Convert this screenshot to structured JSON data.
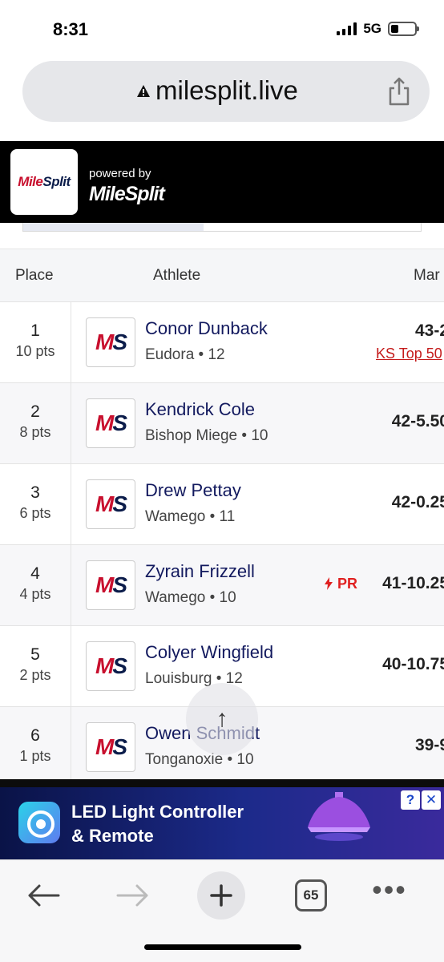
{
  "status_bar": {
    "time": "8:31",
    "network": "5G"
  },
  "browser": {
    "url": "milesplit.live",
    "tab_count": "65"
  },
  "site_header": {
    "logo_text": "MileSplit",
    "powered_by": "powered by",
    "brand": "MileSplit"
  },
  "table": {
    "columns": {
      "place": "Place",
      "athlete": "Athlete",
      "mark": "Mar"
    },
    "badge_text": "MS",
    "rows": [
      {
        "place": "1",
        "pts": "10 pts",
        "name": "Conor Dunback",
        "meta": "Eudora • 12",
        "mark": "43-2",
        "mark_sub": "KS Top 50",
        "pr": ""
      },
      {
        "place": "2",
        "pts": "8 pts",
        "name": "Kendrick Cole",
        "meta": "Bishop Miege • 10",
        "mark": "42-5.50",
        "mark_sub": "",
        "pr": ""
      },
      {
        "place": "3",
        "pts": "6 pts",
        "name": "Drew Pettay",
        "meta": "Wamego • 11",
        "mark": "42-0.25",
        "mark_sub": "",
        "pr": ""
      },
      {
        "place": "4",
        "pts": "4 pts",
        "name": "Zyrain Frizzell",
        "meta": "Wamego • 10",
        "mark": "41-10.25",
        "mark_sub": "",
        "pr": "PR"
      },
      {
        "place": "5",
        "pts": "2 pts",
        "name": "Colyer Wingfield",
        "meta": "Louisburg • 12",
        "mark": "40-10.75",
        "mark_sub": "",
        "pr": ""
      },
      {
        "place": "6",
        "pts": "1 pts",
        "name": "Owen Schmidt",
        "meta": "Tonganoxie • 10",
        "mark": "39-9",
        "mark_sub": "",
        "pr": ""
      }
    ]
  },
  "ad": {
    "line1": "LED Light Controller",
    "line2": "& Remote",
    "info_glyph": "?",
    "close_glyph": "✕"
  },
  "colors": {
    "accent_red": "#c8102e",
    "navy": "#12195e",
    "pr_red": "#e02020"
  },
  "icons": {
    "scroll_top": "arrow-up-icon",
    "back": "arrow-left-icon",
    "forward": "arrow-right-icon",
    "new_tab": "plus-icon",
    "menu": "more-dots-icon",
    "share": "share-icon",
    "warning": "warning-icon"
  },
  "glyphs": {
    "scroll_top": "↑",
    "menu_dots": "•••"
  }
}
